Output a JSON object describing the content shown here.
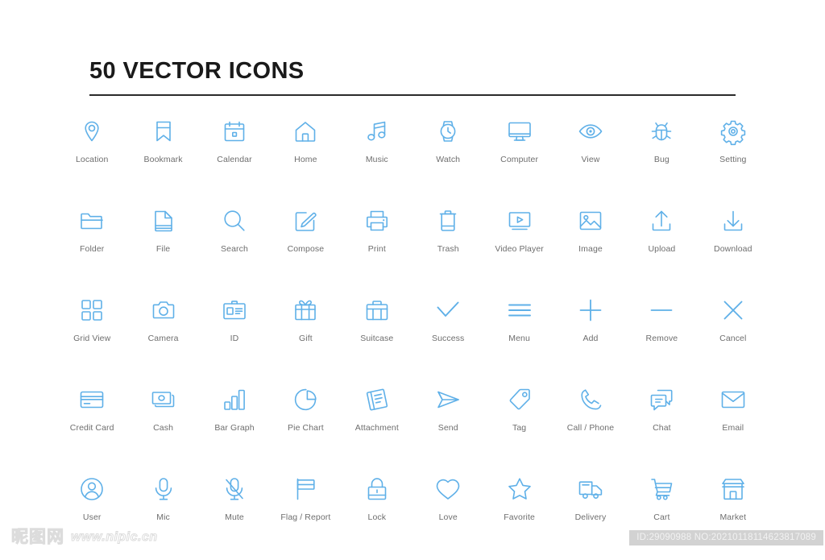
{
  "page": {
    "title": "50 VECTOR ICONS",
    "icon_color": "#5fb0e8",
    "label_color": "#6e6e6e",
    "background": "#ffffff",
    "rule_color": "#2b2b2b"
  },
  "icons": [
    {
      "label": "Location",
      "name": "location-pin-icon"
    },
    {
      "label": "Bookmark",
      "name": "bookmark-icon"
    },
    {
      "label": "Calendar",
      "name": "calendar-icon"
    },
    {
      "label": "Home",
      "name": "home-icon"
    },
    {
      "label": "Music",
      "name": "music-note-icon"
    },
    {
      "label": "Watch",
      "name": "watch-icon"
    },
    {
      "label": "Computer",
      "name": "computer-monitor-icon"
    },
    {
      "label": "View",
      "name": "eye-view-icon"
    },
    {
      "label": "Bug",
      "name": "bug-icon"
    },
    {
      "label": "Setting",
      "name": "gear-setting-icon"
    },
    {
      "label": "Folder",
      "name": "folder-icon"
    },
    {
      "label": "File",
      "name": "file-document-icon"
    },
    {
      "label": "Search",
      "name": "search-magnifier-icon"
    },
    {
      "label": "Compose",
      "name": "compose-pencil-icon"
    },
    {
      "label": "Print",
      "name": "printer-icon"
    },
    {
      "label": "Trash",
      "name": "trash-bin-icon"
    },
    {
      "label": "Video Player",
      "name": "video-player-icon"
    },
    {
      "label": "Image",
      "name": "image-picture-icon"
    },
    {
      "label": "Upload",
      "name": "upload-arrow-icon"
    },
    {
      "label": "Download",
      "name": "download-arrow-icon"
    },
    {
      "label": "Grid View",
      "name": "grid-view-icon"
    },
    {
      "label": "Camera",
      "name": "camera-icon"
    },
    {
      "label": "ID",
      "name": "id-card-icon"
    },
    {
      "label": "Gift",
      "name": "gift-box-icon"
    },
    {
      "label": "Suitcase",
      "name": "suitcase-icon"
    },
    {
      "label": "Success",
      "name": "checkmark-success-icon"
    },
    {
      "label": "Menu",
      "name": "hamburger-menu-icon"
    },
    {
      "label": "Add",
      "name": "plus-add-icon"
    },
    {
      "label": "Remove",
      "name": "minus-remove-icon"
    },
    {
      "label": "Cancel",
      "name": "cross-cancel-icon"
    },
    {
      "label": "Credit Card",
      "name": "credit-card-icon"
    },
    {
      "label": "Cash",
      "name": "cash-money-icon"
    },
    {
      "label": "Bar Graph",
      "name": "bar-graph-icon"
    },
    {
      "label": "Pie Chart",
      "name": "pie-chart-icon"
    },
    {
      "label": "Attachment",
      "name": "attachment-icon"
    },
    {
      "label": "Send",
      "name": "send-paperplane-icon"
    },
    {
      "label": "Tag",
      "name": "tag-icon"
    },
    {
      "label": "Call / Phone",
      "name": "phone-call-icon"
    },
    {
      "label": "Chat",
      "name": "chat-bubbles-icon"
    },
    {
      "label": "Email",
      "name": "email-envelope-icon"
    },
    {
      "label": "User",
      "name": "user-avatar-icon"
    },
    {
      "label": "Mic",
      "name": "microphone-icon"
    },
    {
      "label": "Mute",
      "name": "microphone-mute-icon"
    },
    {
      "label": "Flag / Report",
      "name": "flag-report-icon"
    },
    {
      "label": "Lock",
      "name": "lock-icon"
    },
    {
      "label": "Love",
      "name": "heart-love-icon"
    },
    {
      "label": "Favorite",
      "name": "star-favorite-icon"
    },
    {
      "label": "Delivery",
      "name": "delivery-truck-icon"
    },
    {
      "label": "Cart",
      "name": "shopping-cart-icon"
    },
    {
      "label": "Market",
      "name": "market-store-icon"
    }
  ],
  "footer": {
    "watermark_mark": "昵图网",
    "watermark_url": "www.nipic.cn",
    "id_text": "ID:29090988 NO:20210118114623817089"
  }
}
